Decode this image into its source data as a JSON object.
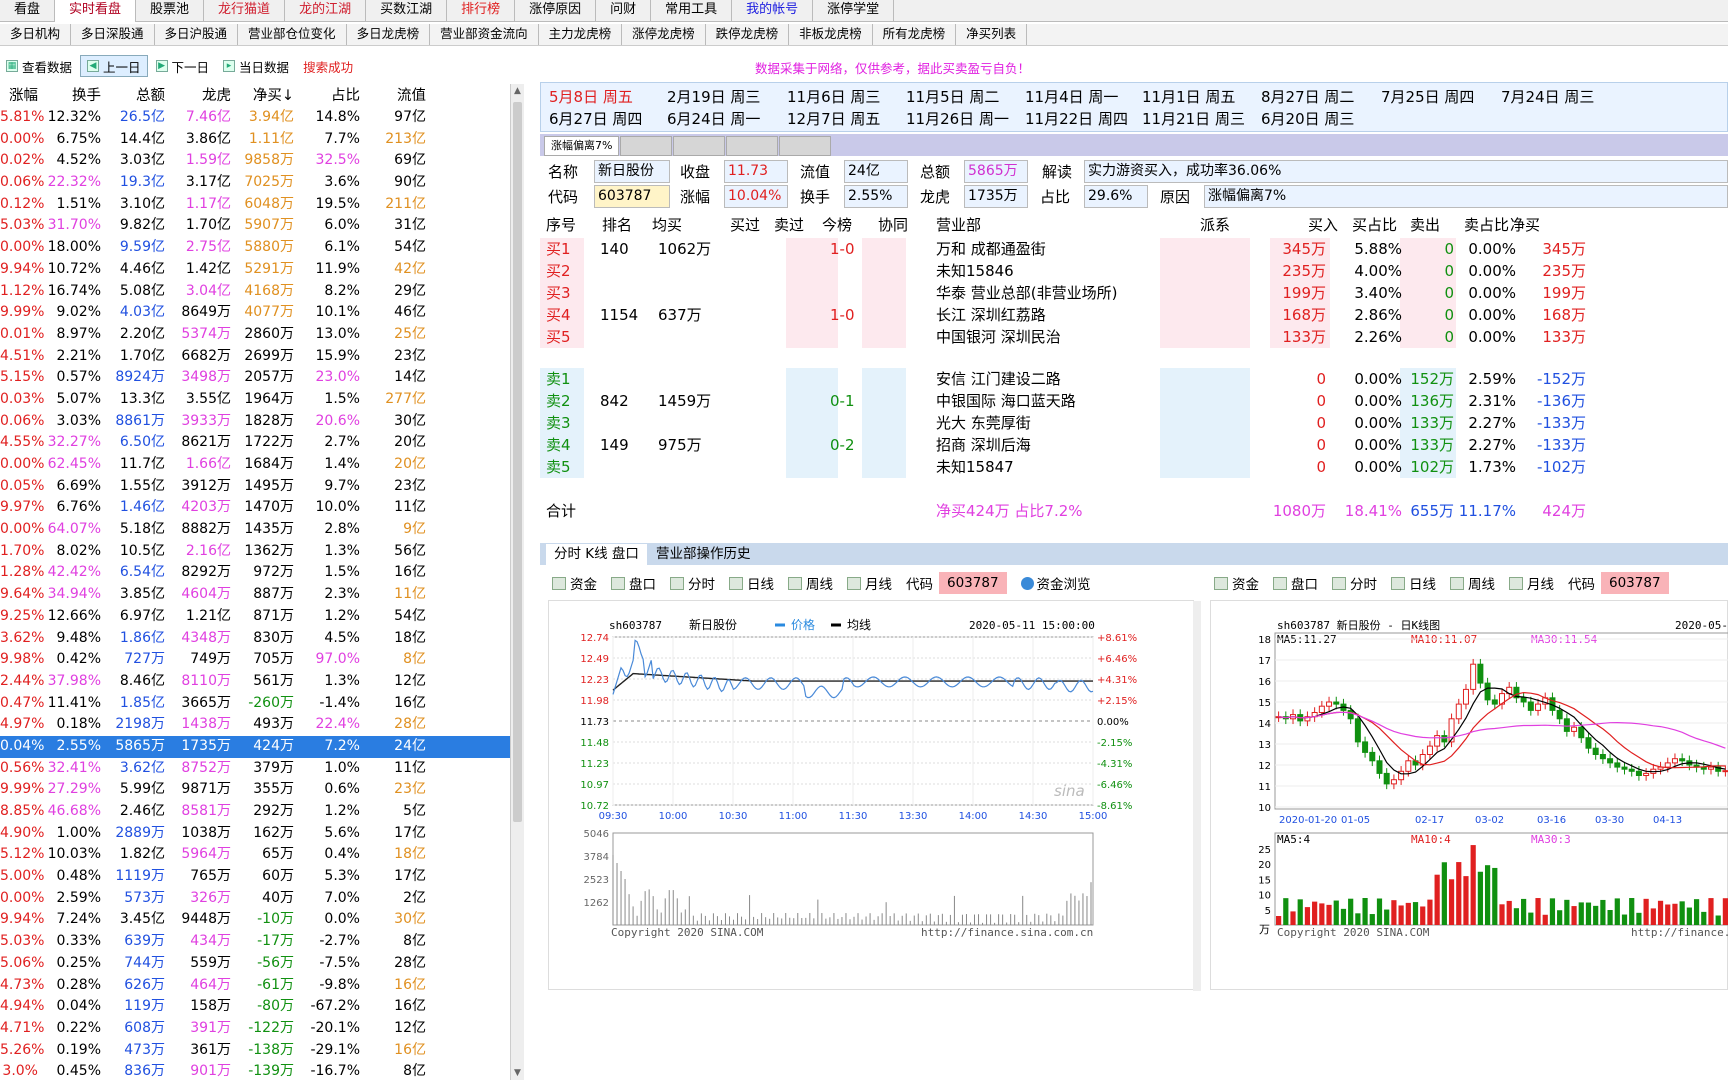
{
  "top_tabs": [
    "看盘",
    "实时看盘",
    "股票池",
    "龙行猫道",
    "龙的江湖",
    "买数江湖",
    "排行榜",
    "涨停原因",
    "问财",
    "常用工具",
    "我的帐号",
    "涨停学堂"
  ],
  "sub_tabs": [
    "多日机构",
    "多日深股通",
    "多日沪股通",
    "营业部仓位变化",
    "多日龙虎榜",
    "营业部资金流向",
    "主力龙虎榜",
    "涨停龙虎榜",
    "跌停龙虎榜",
    "非板龙虎榜",
    "所有龙虎榜",
    "净买列表"
  ],
  "toolbar": {
    "view_data": "查看数据",
    "prev": "上一日",
    "next": "下一日",
    "today": "当日数据",
    "search_status": "搜索成功"
  },
  "notice": "数据采集于网络，仅供参考，据此买卖盈亏自负！",
  "left_table": {
    "headers": [
      "涨幅",
      "换手",
      "总额",
      "龙虎",
      "净买↓",
      "占比",
      "流值"
    ],
    "rows": [
      [
        "5.81%",
        "12.32%",
        "26.5亿",
        "7.46亿",
        "3.94亿",
        "14.8%",
        "97亿"
      ],
      [
        "0.00%",
        "6.75%",
        "14.4亿",
        "3.86亿",
        "1.11亿",
        "7.7%",
        "213亿"
      ],
      [
        "0.02%",
        "4.52%",
        "3.03亿",
        "1.59亿",
        "9858万",
        "32.5%",
        "69亿"
      ],
      [
        "0.06%",
        "22.32%",
        "19.3亿",
        "3.17亿",
        "7025万",
        "3.6%",
        "90亿"
      ],
      [
        "0.12%",
        "1.51%",
        "3.10亿",
        "1.17亿",
        "6048万",
        "19.5%",
        "211亿"
      ],
      [
        "5.03%",
        "31.70%",
        "9.82亿",
        "1.70亿",
        "5907万",
        "6.0%",
        "31亿"
      ],
      [
        "0.00%",
        "18.00%",
        "9.59亿",
        "2.75亿",
        "5880万",
        "6.1%",
        "54亿"
      ],
      [
        "9.94%",
        "10.72%",
        "4.46亿",
        "1.42亿",
        "5291万",
        "11.9%",
        "42亿"
      ],
      [
        "1.12%",
        "16.74%",
        "5.08亿",
        "3.04亿",
        "4168万",
        "8.2%",
        "29亿"
      ],
      [
        "9.99%",
        "9.02%",
        "4.03亿",
        "8649万",
        "4077万",
        "10.1%",
        "46亿"
      ],
      [
        "0.01%",
        "8.97%",
        "2.20亿",
        "5374万",
        "2860万",
        "13.0%",
        "25亿"
      ],
      [
        "4.51%",
        "2.21%",
        "1.70亿",
        "6682万",
        "2699万",
        "15.9%",
        "23亿"
      ],
      [
        "5.15%",
        "0.57%",
        "8924万",
        "3498万",
        "2057万",
        "23.0%",
        "14亿"
      ],
      [
        "0.03%",
        "5.07%",
        "13.3亿",
        "3.55亿",
        "1964万",
        "1.5%",
        "277亿"
      ],
      [
        "0.06%",
        "3.03%",
        "8861万",
        "3933万",
        "1828万",
        "20.6%",
        "30亿"
      ],
      [
        "4.55%",
        "32.27%",
        "6.50亿",
        "8621万",
        "1722万",
        "2.7%",
        "20亿"
      ],
      [
        "0.00%",
        "62.45%",
        "11.7亿",
        "1.66亿",
        "1684万",
        "1.4%",
        "20亿"
      ],
      [
        "0.05%",
        "6.69%",
        "1.55亿",
        "3912万",
        "1495万",
        "9.7%",
        "23亿"
      ],
      [
        "9.97%",
        "6.76%",
        "1.46亿",
        "4203万",
        "1470万",
        "10.0%",
        "11亿"
      ],
      [
        "0.00%",
        "64.07%",
        "5.18亿",
        "8882万",
        "1435万",
        "2.8%",
        "9亿"
      ],
      [
        "1.70%",
        "8.02%",
        "10.5亿",
        "2.16亿",
        "1362万",
        "1.3%",
        "56亿"
      ],
      [
        "1.28%",
        "42.42%",
        "6.54亿",
        "8292万",
        "972万",
        "1.5%",
        "16亿"
      ],
      [
        "9.64%",
        "34.94%",
        "3.85亿",
        "4604万",
        "887万",
        "2.3%",
        "11亿"
      ],
      [
        "9.25%",
        "12.66%",
        "6.97亿",
        "1.21亿",
        "871万",
        "1.2%",
        "54亿"
      ],
      [
        "3.62%",
        "9.48%",
        "1.86亿",
        "4348万",
        "830万",
        "4.5%",
        "18亿"
      ],
      [
        "9.98%",
        "0.42%",
        "727万",
        "749万",
        "705万",
        "97.0%",
        "8亿"
      ],
      [
        "2.44%",
        "37.98%",
        "8.46亿",
        "8110万",
        "561万",
        "1.3%",
        "12亿"
      ],
      [
        "0.47%",
        "11.41%",
        "1.85亿",
        "3665万",
        "-260万",
        "-1.4%",
        "16亿"
      ],
      [
        "4.97%",
        "0.18%",
        "2198万",
        "1438万",
        "493万",
        "22.4%",
        "28亿"
      ],
      [
        "0.04%",
        "2.55%",
        "5865万",
        "1735万",
        "424万",
        "7.2%",
        "24亿"
      ],
      [
        "0.56%",
        "32.41%",
        "3.62亿",
        "8752万",
        "379万",
        "1.0%",
        "11亿"
      ],
      [
        "9.99%",
        "27.29%",
        "5.99亿",
        "9871万",
        "355万",
        "0.6%",
        "23亿"
      ],
      [
        "8.85%",
        "46.68%",
        "2.46亿",
        "8581万",
        "292万",
        "1.2%",
        "5亿"
      ],
      [
        "4.90%",
        "1.00%",
        "2889万",
        "1038万",
        "162万",
        "5.6%",
        "17亿"
      ],
      [
        "5.12%",
        "10.03%",
        "1.82亿",
        "5964万",
        "65万",
        "0.4%",
        "18亿"
      ],
      [
        "5.00%",
        "0.48%",
        "1119万",
        "765万",
        "60万",
        "5.3%",
        "17亿"
      ],
      [
        "0.00%",
        "2.59%",
        "573万",
        "326万",
        "40万",
        "7.0%",
        "2亿"
      ],
      [
        "9.94%",
        "7.24%",
        "3.45亿",
        "9448万",
        "-10万",
        "0.0%",
        "30亿"
      ],
      [
        "5.03%",
        "0.33%",
        "639万",
        "434万",
        "-17万",
        "-2.7%",
        "8亿"
      ],
      [
        "5.06%",
        "0.25%",
        "744万",
        "559万",
        "-56万",
        "-7.5%",
        "28亿"
      ],
      [
        "4.73%",
        "0.28%",
        "626万",
        "464万",
        "-61万",
        "-9.8%",
        "16亿"
      ],
      [
        "4.94%",
        "0.04%",
        "119万",
        "158万",
        "-80万",
        "-67.2%",
        "16亿"
      ],
      [
        "4.71%",
        "0.22%",
        "608万",
        "391万",
        "-122万",
        "-20.1%",
        "12亿"
      ],
      [
        "5.26%",
        "0.19%",
        "473万",
        "361万",
        "-138万",
        "-29.1%",
        "16亿"
      ],
      [
        "3.0%",
        "0.45%",
        "836万",
        "901万",
        "-139万",
        "-16.7%",
        "8亿"
      ]
    ],
    "selected_index": 29
  },
  "dates": [
    "5月8日 周五",
    "2月19日 周三",
    "11月6日 周三",
    "11月5日 周二",
    "11月4日 周一",
    "11月1日 周五",
    "8月27日 周二",
    "7月25日 周四",
    "7月24日 周三",
    "6月27日 周四",
    "6月24日 周一",
    "12月7日 周五",
    "11月26日 周一",
    "11月22日 周四",
    "11月21日 周三",
    "6月20日 周三"
  ],
  "detail_tab": "涨幅偏离7%",
  "stock_info": {
    "name_label": "名称",
    "name": "新日股份",
    "close_label": "收盘",
    "close": "11.73",
    "float_label": "流值",
    "float": "24亿",
    "total_label": "总额",
    "total": "5865万",
    "interp_label": "解读",
    "interp": "实力游资买入，成功率36.06%",
    "code_label": "代码",
    "code": "603787",
    "change_label": "涨幅",
    "change": "10.04%",
    "turnover_label": "换手",
    "turnover": "2.55%",
    "lh_label": "龙虎",
    "lh": "1735万",
    "ratio_label": "占比",
    "ratio": "29.6%",
    "reason_label": "原因",
    "reason": "涨幅偏离7%"
  },
  "detail_headers": [
    "序号",
    "排名",
    "均买",
    "买过",
    "卖过",
    "今榜",
    "协同",
    "营业部",
    "派系",
    "买入",
    "买占比",
    "卖出",
    "卖占比",
    "净买"
  ],
  "buy_rows": [
    {
      "seq": "买1",
      "rank": "140",
      "avg": "1062万",
      "today": "1-0",
      "dept": "万和 成都通盈街",
      "buy": "345万",
      "buyp": "5.88%",
      "sell": "0",
      "sellp": "0.00%",
      "net": "345万"
    },
    {
      "seq": "买2",
      "rank": "",
      "avg": "",
      "today": "",
      "dept": "未知15846",
      "buy": "235万",
      "buyp": "4.00%",
      "sell": "0",
      "sellp": "0.00%",
      "net": "235万"
    },
    {
      "seq": "买3",
      "rank": "",
      "avg": "",
      "today": "",
      "dept": "华泰 营业总部(非营业场所)",
      "buy": "199万",
      "buyp": "3.40%",
      "sell": "0",
      "sellp": "0.00%",
      "net": "199万"
    },
    {
      "seq": "买4",
      "rank": "1154",
      "avg": "637万",
      "today": "1-0",
      "dept": "长江 深圳红荔路",
      "buy": "168万",
      "buyp": "2.86%",
      "sell": "0",
      "sellp": "0.00%",
      "net": "168万"
    },
    {
      "seq": "买5",
      "rank": "",
      "avg": "",
      "today": "",
      "dept": "中国银河 深圳民治",
      "buy": "133万",
      "buyp": "2.26%",
      "sell": "0",
      "sellp": "0.00%",
      "net": "133万"
    }
  ],
  "sell_rows": [
    {
      "seq": "卖1",
      "rank": "",
      "avg": "",
      "today": "",
      "dept": "安信 江门建设二路",
      "buy": "0",
      "buyp": "0.00%",
      "sell": "152万",
      "sellp": "2.59%",
      "net": "-152万"
    },
    {
      "seq": "卖2",
      "rank": "842",
      "avg": "1459万",
      "today": "0-1",
      "dept": "中银国际 海口蓝天路",
      "buy": "0",
      "buyp": "0.00%",
      "sell": "136万",
      "sellp": "2.31%",
      "net": "-136万"
    },
    {
      "seq": "卖3",
      "rank": "",
      "avg": "",
      "today": "",
      "dept": "光大 东莞厚街",
      "buy": "0",
      "buyp": "0.00%",
      "sell": "133万",
      "sellp": "2.27%",
      "net": "-133万"
    },
    {
      "seq": "卖4",
      "rank": "149",
      "avg": "975万",
      "today": "0-2",
      "dept": "招商 深圳后海",
      "buy": "0",
      "buyp": "0.00%",
      "sell": "133万",
      "sellp": "2.27%",
      "net": "-133万"
    },
    {
      "seq": "卖5",
      "rank": "",
      "avg": "",
      "today": "",
      "dept": "未知15847",
      "buy": "0",
      "buyp": "0.00%",
      "sell": "102万",
      "sellp": "1.73%",
      "net": "-102万"
    }
  ],
  "total_row": {
    "label": "合计",
    "summary": "净买424万 占比7.2%",
    "buy": "1080万",
    "buyp": "18.41%",
    "sell": "655万",
    "sellp": "11.17%",
    "net": "424万"
  },
  "bottom_tabs": [
    "分时 K线 盘口",
    "营业部操作历史"
  ],
  "chart_toolbar": [
    "资金",
    "盘口",
    "分时",
    "日线",
    "周线",
    "月线"
  ],
  "code_label": "代码",
  "code_value": "603787",
  "fund_browse": "资金浏览",
  "intraday_chart": {
    "header_code": "sh603787",
    "header_name": "新日股份",
    "legend_price": "价格",
    "legend_avg": "均线",
    "timestamp": "2020-05-11 15:00:00",
    "y_left": [
      "12.74",
      "12.49",
      "12.23",
      "11.98",
      "11.73",
      "11.48",
      "11.23",
      "10.97",
      "10.72"
    ],
    "y_right": [
      "+8.61%",
      "+6.46%",
      "+4.31%",
      "+2.15%",
      "0.00%",
      "-2.15%",
      "-4.31%",
      "-6.46%",
      "-8.61%"
    ],
    "x_ticks": [
      "09:30",
      "10:00",
      "10:30",
      "11:00",
      "11:30",
      "13:30",
      "14:00",
      "14:30",
      "15:00"
    ],
    "vol_ticks": [
      "5046",
      "3784",
      "2523",
      "1262"
    ],
    "copyright": "Copyright 2020 SINA.COM",
    "url": "http://finance.sina.com.cn",
    "watermark": "sina"
  },
  "kline_chart": {
    "header": "sh603787   新日股份 - 日K线图",
    "date_start": "2020-05-",
    "ma5": "MA5:11.27",
    "ma10": "MA10:11.07",
    "ma30": "MA30:11.54",
    "y_ticks": [
      "18",
      "17",
      "16",
      "15",
      "14",
      "13",
      "12",
      "11",
      "10"
    ],
    "x_ticks": [
      "2020-01-20",
      "01-05",
      "02-17",
      "03-02",
      "03-16",
      "03-30",
      "04-13"
    ],
    "vol_ma5": "MA5:4",
    "vol_ma10": "MA10:4",
    "vol_ma30": "MA30:3",
    "vol_ticks": [
      "25",
      "20",
      "15",
      "10",
      "5"
    ],
    "vol_unit": "万",
    "copyright": "Copyright 2020 SINA.COM",
    "url": "http://finance."
  }
}
